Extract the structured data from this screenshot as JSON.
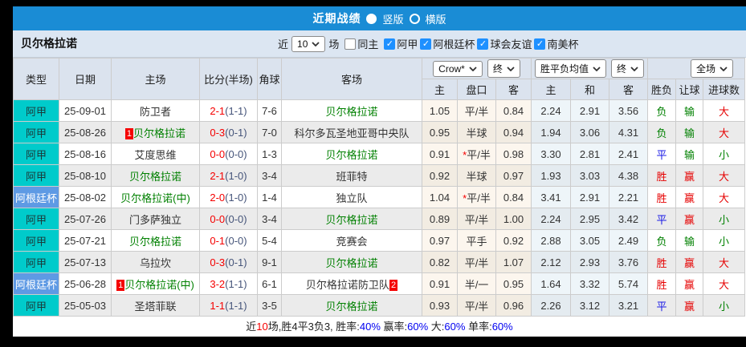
{
  "title_bar": {
    "title": "近期战绩",
    "radio_vertical": "竖版",
    "radio_horizontal": "横版",
    "selected": "竖版"
  },
  "filter": {
    "team": "贝尔格拉诺",
    "near_label": "近",
    "count": "10",
    "matches_label": "场",
    "same_home_label": "同主",
    "same_home_checked": false,
    "leagues": [
      "阿甲",
      "阿根廷杯",
      "球会友谊",
      "南美杯"
    ],
    "check_glyph": "✓"
  },
  "table": {
    "headers": {
      "type": "类型",
      "date": "日期",
      "home": "主场",
      "score": "比分(半场)",
      "corner": "角球",
      "away": "客场",
      "odds_select": "Crow*",
      "odds_final": "终",
      "avg_select": "胜平负均值",
      "avg_final": "终",
      "full_select": "全场",
      "sub": [
        "主",
        "盘口",
        "客",
        "主",
        "和",
        "客",
        "胜负",
        "让球",
        "进球数"
      ]
    },
    "rows": [
      {
        "league": "阿甲",
        "league_class": "c-league",
        "date": "25-09-01",
        "home_badge": "",
        "home": "防卫者",
        "home_self": false,
        "score_ft": "2-1",
        "score_ht": "(1-1)",
        "corner": "7-6",
        "away": "贝尔格拉诺",
        "away_badge": "",
        "away_self": true,
        "odds_home": "1.05",
        "star": "",
        "handicap": "平/半",
        "odds_away": "0.84",
        "avg_home": "2.24",
        "avg_draw": "2.91",
        "avg_away": "3.56",
        "result": "负",
        "result_color": "g",
        "handicap_result": "输",
        "handicap_result_color": "g",
        "goals": "大",
        "goals_color": "r"
      },
      {
        "league": "阿甲",
        "league_class": "c-league",
        "date": "25-08-26",
        "home_badge": "1",
        "home": "贝尔格拉诺",
        "home_self": true,
        "score_ft": "0-3",
        "score_ht": "(0-1)",
        "corner": "7-0",
        "away": "科尔多瓦圣地亚哥中央队",
        "away_badge": "",
        "away_self": false,
        "odds_home": "0.95",
        "star": "",
        "handicap": "半球",
        "odds_away": "0.94",
        "avg_home": "1.94",
        "avg_draw": "3.06",
        "avg_away": "4.31",
        "result": "负",
        "result_color": "g",
        "handicap_result": "输",
        "handicap_result_color": "g",
        "goals": "大",
        "goals_color": "r"
      },
      {
        "league": "阿甲",
        "league_class": "c-league",
        "date": "25-08-16",
        "home_badge": "",
        "home": "艾度思维",
        "home_self": false,
        "score_ft": "0-0",
        "score_ht": "(0-0)",
        "corner": "1-3",
        "away": "贝尔格拉诺",
        "away_badge": "",
        "away_self": true,
        "odds_home": "0.91",
        "star": "*",
        "handicap": "平/半",
        "odds_away": "0.98",
        "avg_home": "3.30",
        "avg_draw": "2.81",
        "avg_away": "2.41",
        "result": "平",
        "result_color": "b",
        "handicap_result": "输",
        "handicap_result_color": "g",
        "goals": "小",
        "goals_color": "g"
      },
      {
        "league": "阿甲",
        "league_class": "c-league",
        "date": "25-08-10",
        "home_badge": "",
        "home": "贝尔格拉诺",
        "home_self": true,
        "score_ft": "2-1",
        "score_ht": "(1-0)",
        "corner": "3-4",
        "away": "班菲特",
        "away_badge": "",
        "away_self": false,
        "odds_home": "0.92",
        "star": "",
        "handicap": "半球",
        "odds_away": "0.97",
        "avg_home": "1.93",
        "avg_draw": "3.03",
        "avg_away": "4.38",
        "result": "胜",
        "result_color": "r",
        "handicap_result": "赢",
        "handicap_result_color": "r",
        "goals": "大",
        "goals_color": "r"
      },
      {
        "league": "阿根廷杯",
        "league_class": "c-cup",
        "date": "25-08-02",
        "home_badge": "",
        "home": "贝尔格拉诺(中)",
        "home_self": true,
        "score_ft": "2-0",
        "score_ht": "(1-0)",
        "corner": "1-4",
        "away": "独立队",
        "away_badge": "",
        "away_self": false,
        "odds_home": "1.04",
        "star": "*",
        "handicap": "平/半",
        "odds_away": "0.84",
        "avg_home": "3.41",
        "avg_draw": "2.91",
        "avg_away": "2.21",
        "result": "胜",
        "result_color": "r",
        "handicap_result": "赢",
        "handicap_result_color": "r",
        "goals": "大",
        "goals_color": "r"
      },
      {
        "league": "阿甲",
        "league_class": "c-league",
        "date": "25-07-26",
        "home_badge": "",
        "home": "门多萨独立",
        "home_self": false,
        "score_ft": "0-0",
        "score_ht": "(0-0)",
        "corner": "3-4",
        "away": "贝尔格拉诺",
        "away_badge": "",
        "away_self": true,
        "odds_home": "0.89",
        "star": "",
        "handicap": "平/半",
        "odds_away": "1.00",
        "avg_home": "2.24",
        "avg_draw": "2.95",
        "avg_away": "3.42",
        "result": "平",
        "result_color": "b",
        "handicap_result": "赢",
        "handicap_result_color": "r",
        "goals": "小",
        "goals_color": "g"
      },
      {
        "league": "阿甲",
        "league_class": "c-league",
        "date": "25-07-21",
        "home_badge": "",
        "home": "贝尔格拉诺",
        "home_self": true,
        "score_ft": "0-1",
        "score_ht": "(0-0)",
        "corner": "5-4",
        "away": "竞赛会",
        "away_badge": "",
        "away_self": false,
        "odds_home": "0.97",
        "star": "",
        "handicap": "平手",
        "odds_away": "0.92",
        "avg_home": "2.88",
        "avg_draw": "3.05",
        "avg_away": "2.49",
        "result": "负",
        "result_color": "g",
        "handicap_result": "输",
        "handicap_result_color": "g",
        "goals": "小",
        "goals_color": "g"
      },
      {
        "league": "阿甲",
        "league_class": "c-league",
        "date": "25-07-13",
        "home_badge": "",
        "home": "乌拉坎",
        "home_self": false,
        "score_ft": "0-3",
        "score_ht": "(0-1)",
        "corner": "9-1",
        "away": "贝尔格拉诺",
        "away_badge": "",
        "away_self": true,
        "odds_home": "0.82",
        "star": "",
        "handicap": "平/半",
        "odds_away": "1.07",
        "avg_home": "2.12",
        "avg_draw": "2.93",
        "avg_away": "3.76",
        "result": "胜",
        "result_color": "r",
        "handicap_result": "赢",
        "handicap_result_color": "r",
        "goals": "大",
        "goals_color": "r"
      },
      {
        "league": "阿根廷杯",
        "league_class": "c-cup",
        "date": "25-06-28",
        "home_badge": "1",
        "home": "贝尔格拉诺(中)",
        "home_self": true,
        "score_ft": "3-2",
        "score_ht": "(1-1)",
        "corner": "6-1",
        "away": "贝尔格拉诺防卫队",
        "away_badge": "2",
        "away_self": false,
        "odds_home": "0.91",
        "star": "",
        "handicap": "半/一",
        "odds_away": "0.95",
        "avg_home": "1.64",
        "avg_draw": "3.32",
        "avg_away": "5.74",
        "result": "胜",
        "result_color": "r",
        "handicap_result": "赢",
        "handicap_result_color": "r",
        "goals": "大",
        "goals_color": "r"
      },
      {
        "league": "阿甲",
        "league_class": "c-league",
        "date": "25-05-03",
        "home_badge": "",
        "home": "圣塔菲联",
        "home_self": false,
        "score_ft": "1-1",
        "score_ht": "(1-1)",
        "corner": "3-5",
        "away": "贝尔格拉诺",
        "away_badge": "",
        "away_self": true,
        "odds_home": "0.93",
        "star": "",
        "handicap": "平/半",
        "odds_away": "0.96",
        "avg_home": "2.26",
        "avg_draw": "3.12",
        "avg_away": "3.21",
        "result": "平",
        "result_color": "b",
        "handicap_result": "赢",
        "handicap_result_color": "r",
        "goals": "小",
        "goals_color": "g"
      }
    ]
  },
  "summary": {
    "segments": [
      {
        "text": "近",
        "color": "black"
      },
      {
        "text": "10",
        "color": "red"
      },
      {
        "text": "场,胜4平3负3, 胜率:",
        "color": "black"
      },
      {
        "text": "40%",
        "color": "blue"
      },
      {
        "text": " 赢率:",
        "color": "black"
      },
      {
        "text": "60%",
        "color": "blue"
      },
      {
        "text": " 大:",
        "color": "black"
      },
      {
        "text": "60%",
        "color": "blue"
      },
      {
        "text": " 单率:",
        "color": "black"
      },
      {
        "text": "60%",
        "color": "blue"
      }
    ]
  },
  "colors": {
    "title_bar_bg": "#1a8cd5",
    "league_cell_bg": "#00cbcb",
    "cup_cell_bg": "#5e9ae4",
    "self_team_green": "#008000",
    "score_red": "#f50000",
    "halftime_dark": "#46557a",
    "win_red": "#e60000",
    "draw_blue": "#1a1ae6",
    "loss_green": "#008000",
    "checkbox_blue": "#1e90ff",
    "percent_blue": "#0000f0",
    "header_bg": "#dbe3ee",
    "filter_bg": "#dce6f2"
  }
}
